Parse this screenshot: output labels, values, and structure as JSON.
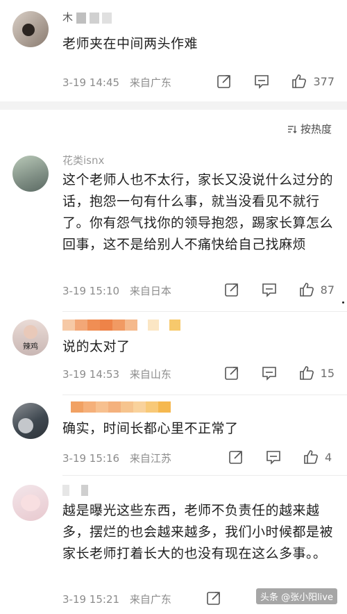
{
  "sort_label": "按热度",
  "comments": [
    {
      "username": "木",
      "text": "老师夹在中间两头作难",
      "date": "3-19 14:45",
      "location": "来自广东",
      "likes": "377"
    },
    {
      "username": "花类isnx",
      "text": "这个老师人也不太行，家长又没说什么过分的话，抱怨一句有什么事，就当没看见不就行了。你有怨气找你的领导抱怨，踢家长算怎么回事，这不是给别人不痛快给自己找麻烦",
      "date": "3-19 15:10",
      "location": "来自日本",
      "likes": "87"
    },
    {
      "username": "",
      "avatar_text": "辣鸡",
      "text": "说的太对了",
      "date": "3-19 14:53",
      "location": "来自山东",
      "likes": "15"
    },
    {
      "username": "",
      "text": "确实，时间长都心里不正常了",
      "date": "3-19 15:16",
      "location": "来自江苏",
      "likes": "4"
    },
    {
      "username": "",
      "text": "越是曝光这些东西，老师不负责任的越来越多，摆烂的也会越来越多，我们小时候都是被家长老师打着长大的也没有现在这么多事。。",
      "date": "3-19 15:21",
      "location": "来自广东",
      "likes": ""
    }
  ],
  "watermark": "头条 @张小阳live",
  "colors": {
    "meta": "#8c8c8c",
    "divider": "#f3f3f3",
    "text": "#1f1f1f"
  },
  "icons": [
    "share-icon",
    "comment-icon",
    "like-icon",
    "sort-icon"
  ]
}
